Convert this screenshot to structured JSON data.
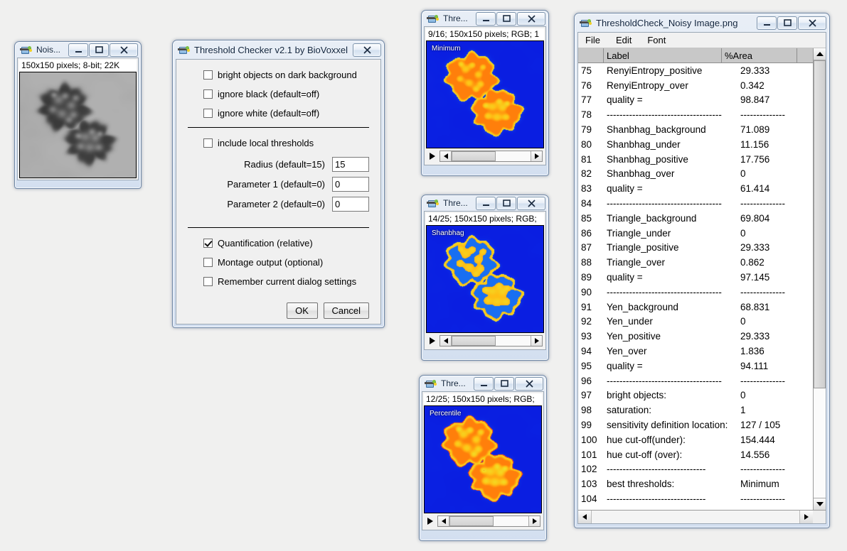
{
  "noise_window": {
    "title": "Nois...",
    "status": "150x150 pixels; 8-bit; 22K",
    "buttons": {
      "minimize": "minimize-icon",
      "maximize": "maximize-icon",
      "close": "close-icon"
    }
  },
  "dialog": {
    "title": "Threshold Checker v2.1 by BioVoxxel",
    "close_label": "close-icon",
    "checkboxes_top": [
      {
        "label": "bright objects on dark background",
        "checked": false
      },
      {
        "label": "ignore black (default=off)",
        "checked": false
      },
      {
        "label": "ignore white (default=off)",
        "checked": false
      }
    ],
    "local_thresholds": {
      "label": "include local thresholds",
      "checked": false
    },
    "fields": [
      {
        "label": "Radius (default=15)",
        "value": "15"
      },
      {
        "label": "Parameter 1 (default=0)",
        "value": "0"
      },
      {
        "label": "Parameter 2 (default=0)",
        "value": "0"
      }
    ],
    "checkboxes_bottom": [
      {
        "label": "Quantification (relative)",
        "checked": true
      },
      {
        "label": "Montage output (optional)",
        "checked": false
      },
      {
        "label": "Remember current dialog settings",
        "checked": false
      }
    ],
    "ok_label": "OK",
    "cancel_label": "Cancel"
  },
  "image_windows": [
    {
      "title": "Thre...",
      "status": "9/16; 150x150 pixels; RGB; 1",
      "overlay_label": "Minimum",
      "style": "minimum"
    },
    {
      "title": "Thre...",
      "status": "14/25; 150x150 pixels; RGB;",
      "overlay_label": "Shanbhag",
      "style": "shanbhag"
    },
    {
      "title": "Thre...",
      "status": "12/25; 150x150 pixels; RGB;",
      "overlay_label": "Percentile",
      "style": "percentile"
    }
  ],
  "results_window": {
    "title": "ThresholdCheck_Noisy Image.png",
    "menu": [
      "File",
      "Edit",
      "Font"
    ],
    "columns": [
      "",
      "Label",
      "%Area",
      ""
    ],
    "rows": [
      {
        "n": "75",
        "label": "RenyiEntropy_positive",
        "area": "29.333"
      },
      {
        "n": "76",
        "label": "RenyiEntropy_over",
        "area": "0.342"
      },
      {
        "n": "77",
        "label": "quality =",
        "area": "98.847"
      },
      {
        "n": "78",
        "label": "------------------------------------",
        "area": "--------------"
      },
      {
        "n": "79",
        "label": "Shanbhag_background",
        "area": "71.089"
      },
      {
        "n": "80",
        "label": "Shanbhag_under",
        "area": "11.156"
      },
      {
        "n": "81",
        "label": "Shanbhag_positive",
        "area": "17.756"
      },
      {
        "n": "82",
        "label": "Shanbhag_over",
        "area": "0"
      },
      {
        "n": "83",
        "label": "quality =",
        "area": "61.414"
      },
      {
        "n": "84",
        "label": "------------------------------------",
        "area": "--------------"
      },
      {
        "n": "85",
        "label": "Triangle_background",
        "area": "69.804"
      },
      {
        "n": "86",
        "label": "Triangle_under",
        "area": "0"
      },
      {
        "n": "87",
        "label": "Triangle_positive",
        "area": "29.333"
      },
      {
        "n": "88",
        "label": "Triangle_over",
        "area": "0.862"
      },
      {
        "n": "89",
        "label": "quality =",
        "area": "97.145"
      },
      {
        "n": "90",
        "label": "------------------------------------",
        "area": "--------------"
      },
      {
        "n": "91",
        "label": "Yen_background",
        "area": "68.831"
      },
      {
        "n": "92",
        "label": "Yen_under",
        "area": "0"
      },
      {
        "n": "93",
        "label": "Yen_positive",
        "area": "29.333"
      },
      {
        "n": "94",
        "label": "Yen_over",
        "area": "1.836"
      },
      {
        "n": "95",
        "label": "quality =",
        "area": "94.111"
      },
      {
        "n": "96",
        "label": "------------------------------------",
        "area": "--------------"
      },
      {
        "n": "97",
        "label": "bright objects:",
        "area": "0"
      },
      {
        "n": "98",
        "label": "saturation:",
        "area": "1"
      },
      {
        "n": "99",
        "label": "sensitivity definition location:",
        "area": "127 / 105"
      },
      {
        "n": "100",
        "label": "hue cut-off(under):",
        "area": "154.444"
      },
      {
        "n": "101",
        "label": "hue cut-off (over):",
        "area": "14.556"
      },
      {
        "n": "102",
        "label": "-------------------------------",
        "area": "--------------"
      },
      {
        "n": "103",
        "label": "best thresholds:",
        "area": "Minimum"
      },
      {
        "n": "104",
        "label": "-------------------------------",
        "area": "--------------"
      }
    ]
  },
  "colors": {
    "desktop": "#f0f0ef",
    "title_gradient_top": "#e8eef6",
    "title_gradient_bottom": "#d3dff0",
    "lut_blue": "#0033ff",
    "lut_yellow": "#ffe000",
    "lut_orange": "#ff8800",
    "lut_red": "#ff2200"
  }
}
